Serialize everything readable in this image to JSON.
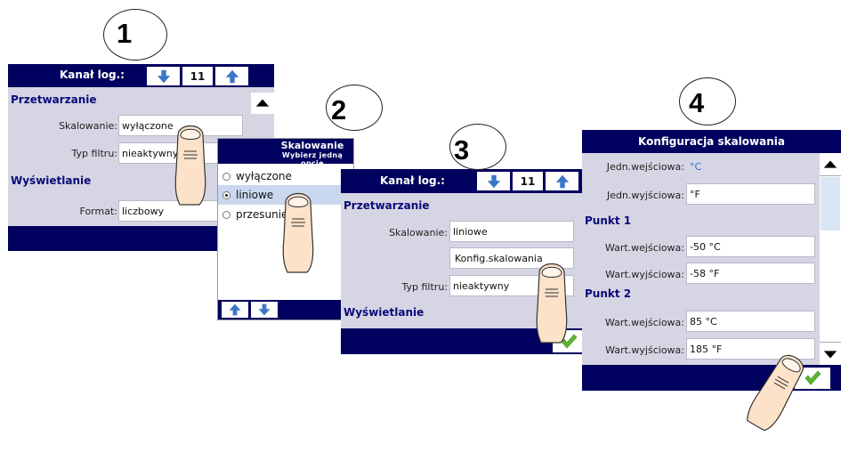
{
  "steps": {
    "s1": "1",
    "s2": "2",
    "s3": "3",
    "s4": "4"
  },
  "colors": {
    "header": "#00005e",
    "panel": "#d6d5e3",
    "section_text": "#0a0a7a",
    "arrow_blue": "#3b76c8",
    "check_green": "#5cb531"
  },
  "screen1": {
    "header_label": "Kanał log.:",
    "channel": "11",
    "section_processing": "Przetwarzanie",
    "scaling_label": "Skalowanie:",
    "scaling_value": "wyłączone",
    "filter_label": "Typ filtru:",
    "filter_value": "nieaktywny",
    "section_display": "Wyświetlanie",
    "format_label": "Format:",
    "format_value": "liczbowy"
  },
  "screen2": {
    "title": "Skalowanie",
    "subtitle": "Wybierz jedną opcję",
    "options": [
      "wyłączone",
      "liniowe",
      "przesunię"
    ],
    "selected_index": 1
  },
  "screen3": {
    "header_label": "Kanał log.:",
    "channel": "11",
    "section_processing": "Przetwarzanie",
    "scaling_label": "Skalowanie:",
    "scaling_value": "liniowe",
    "config_button": "Konfig.skalowania",
    "filter_label": "Typ filtru:",
    "filter_value": "nieaktywny",
    "section_display": "Wyświetlanie"
  },
  "screen4": {
    "title": "Konfiguracja skalowania",
    "in_unit_label": "Jedn.wejściowa:",
    "in_unit_value": "°C",
    "out_unit_label": "Jedn.wyjściowa:",
    "out_unit_value": "°F",
    "point1_title": "Punkt 1",
    "p1_in_label": "Wart.wejściowa:",
    "p1_in_value": "-50 °C",
    "p1_out_label": "Wart.wyjściowa:",
    "p1_out_value": "-58 °F",
    "point2_title": "Punkt 2",
    "p2_in_label": "Wart.wejściowa:",
    "p2_in_value": "85 °C",
    "p2_out_label": "Wart.wyjściowa:",
    "p2_out_value": "185 °F"
  },
  "icons": [
    "arrow-down-icon",
    "arrow-up-icon",
    "scroll-up-icon",
    "scroll-down-icon",
    "checkmark-icon",
    "pointing-finger-icon"
  ]
}
